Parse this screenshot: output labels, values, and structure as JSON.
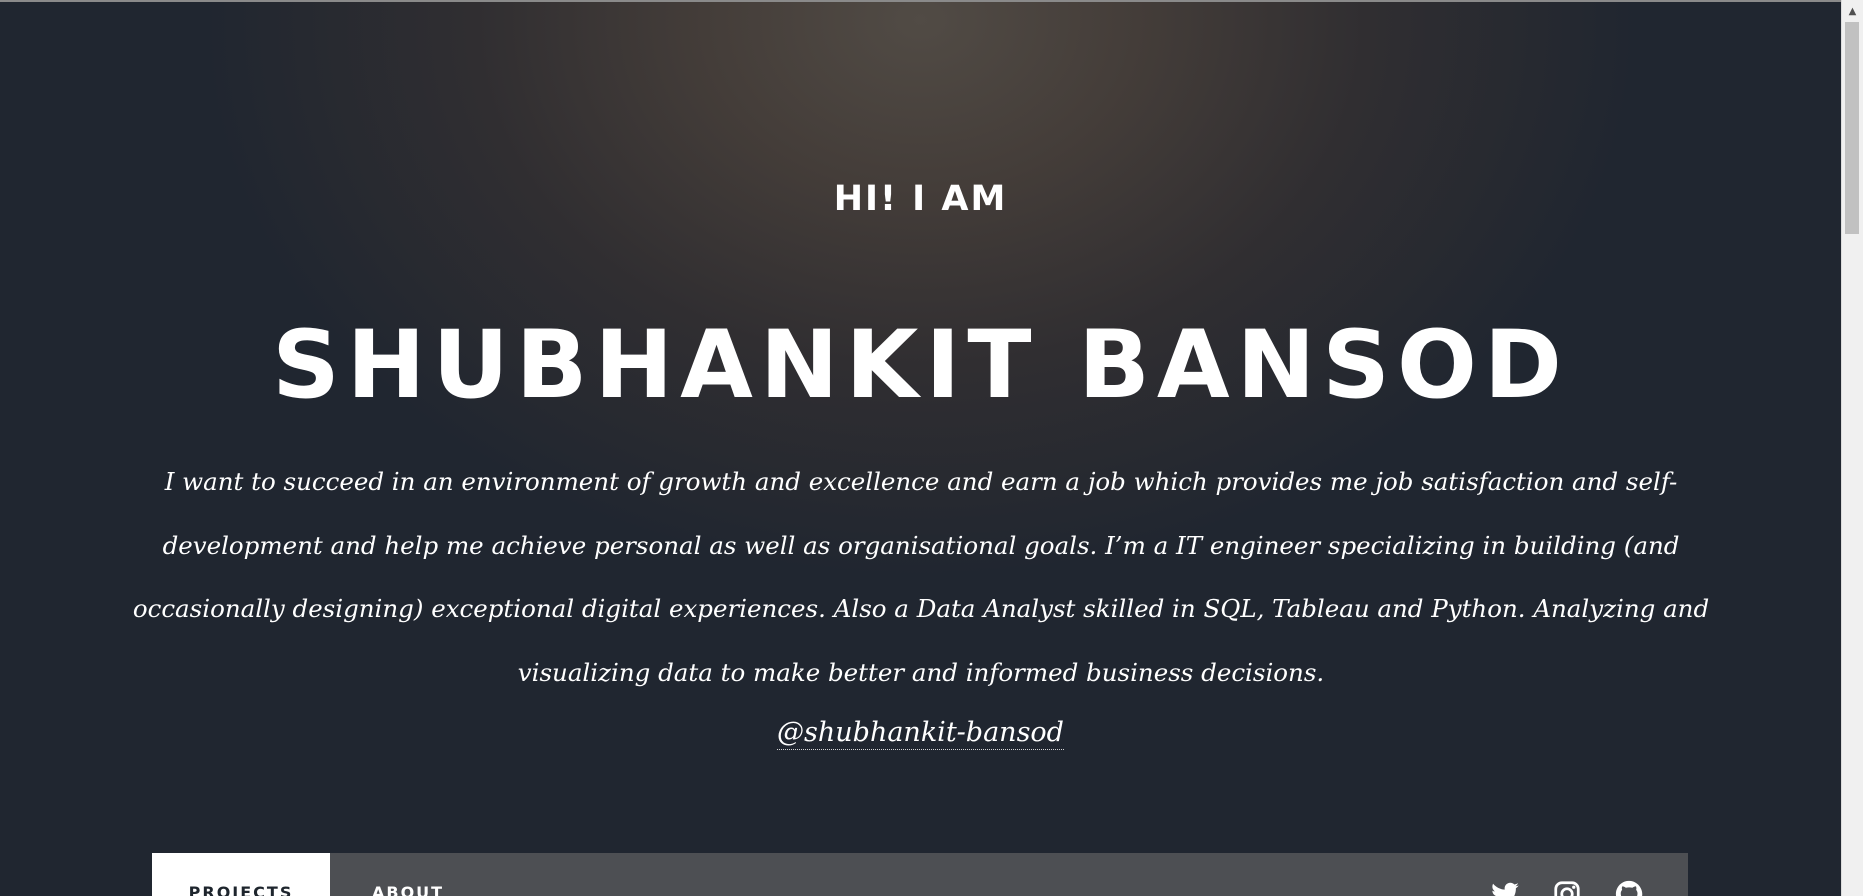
{
  "hero": {
    "greeting": "HI! I AM",
    "name": "SHUBHANKIT BANSOD",
    "bio": "I want to succeed in an environment of growth and excellence and earn a job which provides me job satisfaction and self-development and help me achieve personal as well as organisational goals. I’m a IT engineer specializing in building (and occasionally designing) exceptional digital experiences. Also a Data Analyst skilled in SQL, Tableau and Python. Analyzing and visualizing data to make better and informed business decisions.",
    "handle": "@shubhankit-bansod"
  },
  "nav": {
    "tabs": [
      {
        "label": "PROJECTS",
        "active": true
      },
      {
        "label": "ABOUT",
        "active": false
      }
    ],
    "social_icons": [
      "twitter-icon",
      "instagram-icon",
      "github-icon"
    ]
  },
  "scrollbar": {
    "up_arrow": "▲"
  },
  "colors": {
    "background_dark": "#202630",
    "background_glow": "#514b45",
    "text": "#ffffff",
    "nav_bar": "#4d4f53",
    "active_tab": "#ffffff"
  }
}
